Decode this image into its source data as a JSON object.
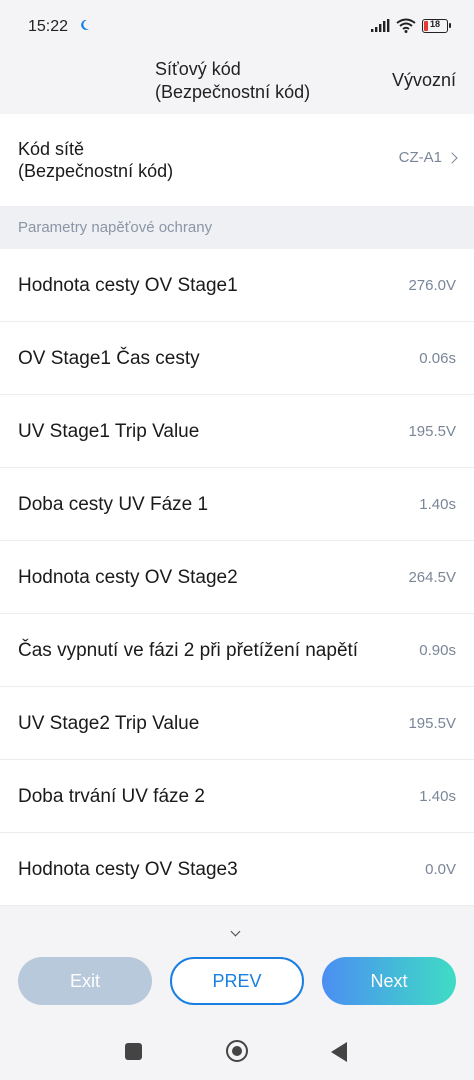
{
  "status_bar": {
    "time": "15:22",
    "battery_level": "18",
    "battery_percent": 18,
    "battery_color": "#e53935"
  },
  "header": {
    "title": "Síťový kód\n(Bezpečnostní kód)",
    "action": "Vývozní"
  },
  "grid_code": {
    "label": "Kód sítě\n(Bezpečnostní kód)",
    "value": "CZ-A1"
  },
  "section": {
    "title": "Parametry napěťové ochrany"
  },
  "params": [
    {
      "label": "Hodnota cesty OV Stage1",
      "value": "276.0V"
    },
    {
      "label": "OV Stage1 Čas cesty",
      "value": "0.06s"
    },
    {
      "label": "UV Stage1 Trip Value",
      "value": "195.5V"
    },
    {
      "label": "Doba cesty UV Fáze 1",
      "value": "1.40s"
    },
    {
      "label": "Hodnota cesty OV Stage2",
      "value": "264.5V"
    },
    {
      "label": "Čas vypnutí ve fázi 2 při přetížení napětí",
      "value": "0.90s"
    },
    {
      "label": "UV Stage2 Trip Value",
      "value": "195.5V"
    },
    {
      "label": "Doba trvání UV fáze 2",
      "value": "1.40s"
    },
    {
      "label": "Hodnota cesty OV Stage3",
      "value": "0.0V"
    }
  ],
  "footer": {
    "exit_label": "Exit",
    "prev_label": "PREV",
    "next_label": "Next"
  },
  "colors": {
    "accent": "#1a7fe0",
    "next_gradient_start": "#4b8ff2",
    "next_gradient_end": "#3fdcc4",
    "exit_disabled": "#b9c9dc",
    "value_text": "#7a8697"
  },
  "icons": {
    "moon": "moon-icon",
    "signal": "signal-icon",
    "wifi": "wifi-icon",
    "battery": "battery-icon",
    "chevron": "chevron-right-icon",
    "scroll_hint": "chevron-down-icon",
    "nav_recents": "square-icon",
    "nav_home": "circle-icon",
    "nav_back": "triangle-back-icon"
  }
}
